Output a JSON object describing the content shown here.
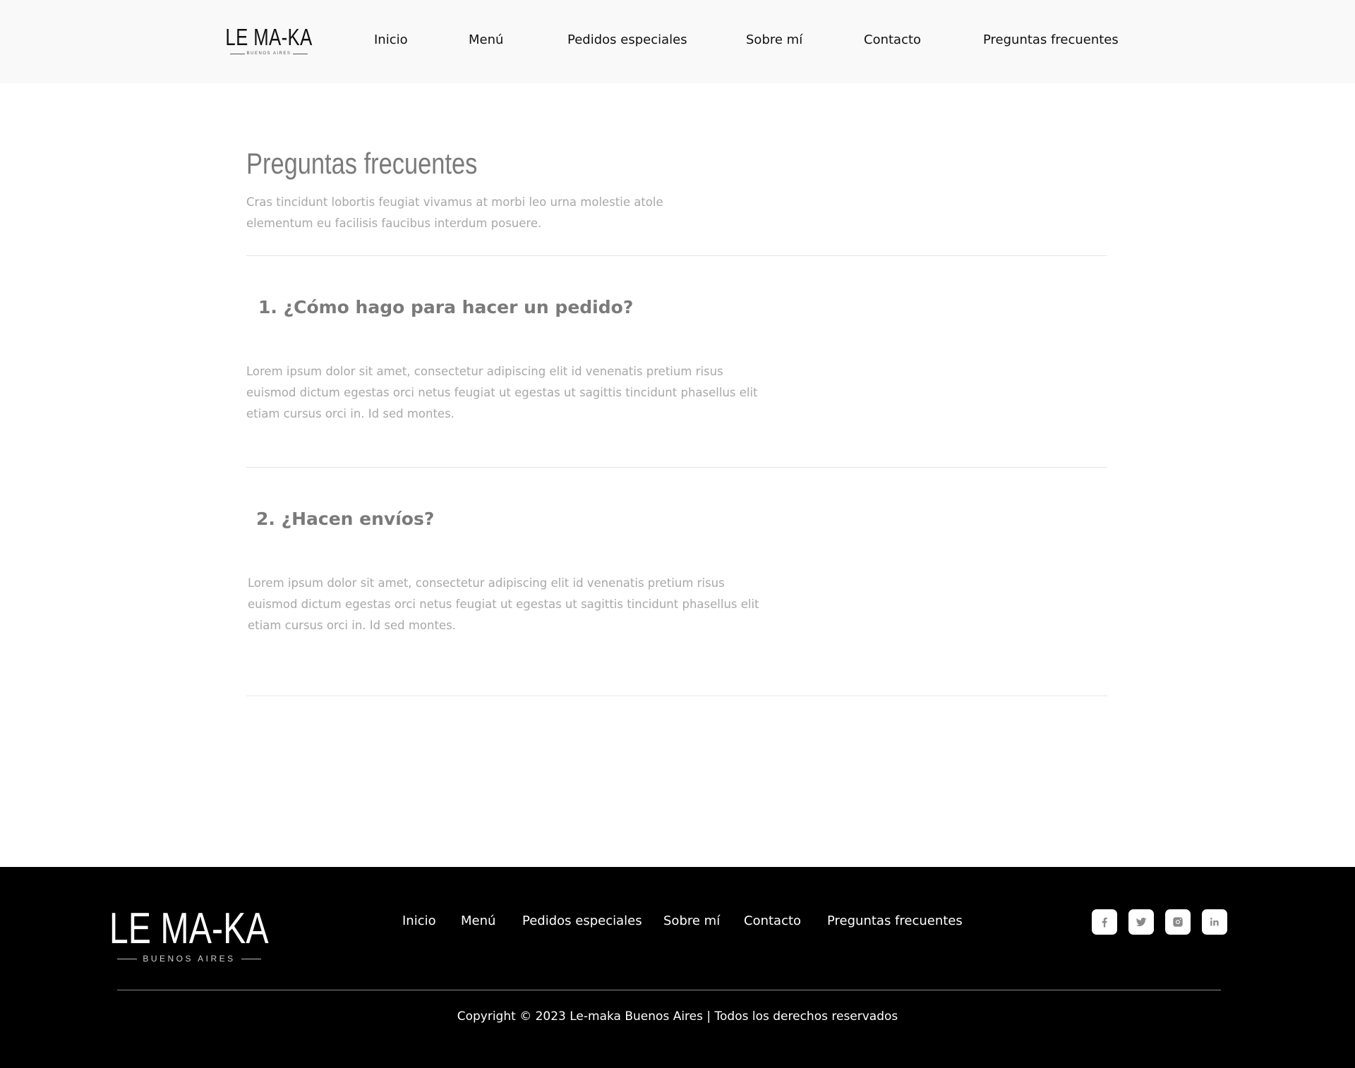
{
  "brand": {
    "name": "LE MA-KA",
    "tagline": "BUENOS AIRES"
  },
  "nav": {
    "items": [
      "Inicio",
      "Menú",
      "Pedidos especiales",
      "Sobre mí",
      "Contacto",
      "Preguntas frecuentes"
    ]
  },
  "main": {
    "title": "Preguntas frecuentes",
    "intro": "Cras tincidunt lobortis feugiat vivamus at morbi leo urna molestie atole elementum eu facilisis faucibus interdum posuere.",
    "faqs": [
      {
        "question": "1. ¿Cómo hago para hacer un pedido?",
        "answer": "Lorem ipsum dolor sit amet, consectetur adipiscing elit id venenatis pretium risus euismod dictum egestas orci netus feugiat ut egestas ut sagittis tincidunt phasellus elit etiam cursus orci in. Id sed montes."
      },
      {
        "question": "2. ¿Hacen envíos?",
        "answer": "Lorem ipsum dolor sit amet, consectetur adipiscing elit id venenatis pretium risus euismod dictum egestas orci netus feugiat ut egestas ut sagittis tincidunt phasellus elit etiam cursus orci in. Id sed montes."
      }
    ]
  },
  "footer": {
    "nav": [
      "Inicio",
      "Menú",
      "Pedidos especiales",
      "Sobre mí",
      "Contacto",
      "Preguntas frecuentes"
    ],
    "social": [
      "facebook-icon",
      "twitter-icon",
      "instagram-icon",
      "linkedin-icon"
    ],
    "copyright": "Copyright © 2023 Le-maka Buenos Aires | Todos los derechos reservados"
  },
  "colors": {
    "header_bg": "#f9f9f9",
    "footer_bg": "#000000",
    "heading": "#7a7a7a",
    "body_text": "#a8a8a8",
    "divider": "#e6e6e6"
  }
}
